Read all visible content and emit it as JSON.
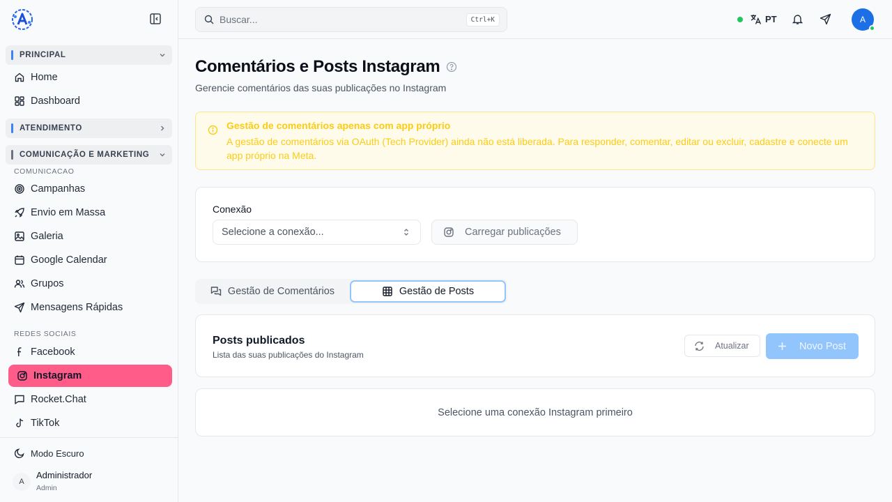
{
  "colors": {
    "accent": "#1d6fe6",
    "active_nav": "#ff5c8a",
    "warning_text": "#facc15",
    "primary_button": "#93c5fd",
    "online": "#22c55e",
    "section_principal": "#3b82f6",
    "section_atendimento": "#3b82f6",
    "section_comunicacao": "#6b7280"
  },
  "sidebar": {
    "sections": [
      {
        "label": "PRINCIPAL",
        "expanded": true
      },
      {
        "label": "ATENDIMENTO",
        "expanded": false
      },
      {
        "label": "COMUNICAÇÃO E MARKETING",
        "expanded": true
      }
    ],
    "principal_items": [
      {
        "label": "Home",
        "icon": "home-icon"
      },
      {
        "label": "Dashboard",
        "icon": "dashboard-icon"
      }
    ],
    "subheading_comunicacao": "COMUNICACAO",
    "comunicacao_items": [
      {
        "label": "Campanhas",
        "icon": "target-icon"
      },
      {
        "label": "Envio em Massa",
        "icon": "rocket-icon"
      },
      {
        "label": "Galeria",
        "icon": "image-icon"
      },
      {
        "label": "Google Calendar",
        "icon": "calendar-icon"
      },
      {
        "label": "Grupos",
        "icon": "users-icon"
      },
      {
        "label": "Mensagens Rápidas",
        "icon": "send-icon"
      }
    ],
    "subheading_redes": "REDES SOCIAIS",
    "redes_items": [
      {
        "label": "Facebook",
        "icon": "facebook-icon",
        "active": false
      },
      {
        "label": "Instagram",
        "icon": "instagram-icon",
        "active": true
      },
      {
        "label": "Rocket.Chat",
        "icon": "chat-icon",
        "active": false
      },
      {
        "label": "TikTok",
        "icon": "tiktok-icon",
        "active": false
      }
    ],
    "dark_mode_label": "Modo Escuro",
    "user": {
      "initial": "A",
      "name": "Administrador",
      "role": "Admin"
    }
  },
  "topbar": {
    "search_placeholder": "Buscar...",
    "shortcut": "Ctrl+K",
    "language": "PT",
    "avatar_initial": "A"
  },
  "main": {
    "title": "Comentários e Posts Instagram",
    "subtitle": "Gerencie comentários das suas publicações no Instagram",
    "alert": {
      "title": "Gestão de comentários apenas com app próprio",
      "body": "A gestão de comentários via OAuth (Tech Provider) ainda não está liberada. Para responder, comentar, editar ou excluir, cadastre e conecte um app próprio na Meta."
    },
    "connection": {
      "label": "Conexão",
      "select_placeholder": "Selecione a conexão...",
      "load_button": "Carregar publicações"
    },
    "tabs": [
      {
        "label": "Gestão de Comentários",
        "active": false
      },
      {
        "label": "Gestão de Posts",
        "active": true
      }
    ],
    "posts": {
      "title": "Posts publicados",
      "subtitle": "Lista das suas publicações do Instagram",
      "refresh_button": "Atualizar",
      "new_button": "Novo Post"
    },
    "empty_message": "Selecione uma conexão Instagram primeiro"
  }
}
